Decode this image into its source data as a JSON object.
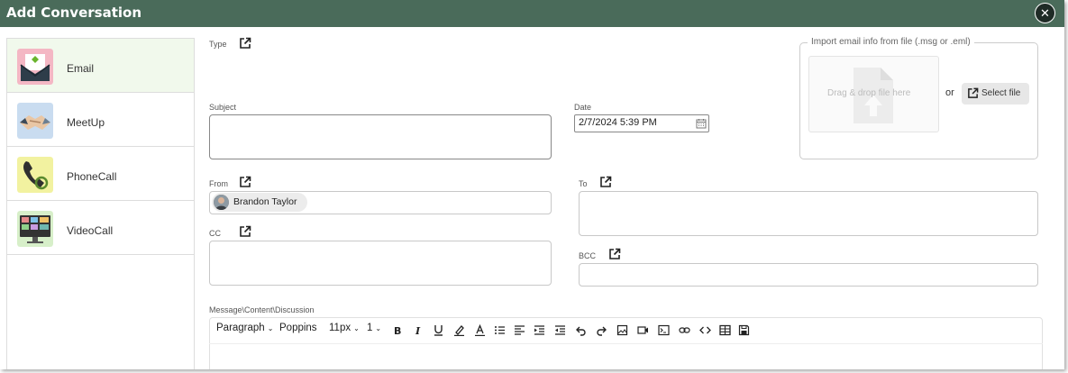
{
  "dialog": {
    "title": "Add Conversation",
    "close_glyph": "✕"
  },
  "sidebar": {
    "items": [
      {
        "label": "Email",
        "icon": "email-envelope-icon",
        "active": true
      },
      {
        "label": "MeetUp",
        "icon": "handshake-icon",
        "active": false
      },
      {
        "label": "PhoneCall",
        "icon": "phone-icon",
        "active": false
      },
      {
        "label": "VideoCall",
        "icon": "video-grid-icon",
        "active": false
      }
    ]
  },
  "form": {
    "type_label": "Type",
    "subject_label": "Subject",
    "subject_value": "",
    "date_label": "Date",
    "date_value": "2/7/2024 5:39 PM",
    "from_label": "From",
    "from_chip": "Brandon Taylor",
    "to_label": "To",
    "cc_label": "CC",
    "bcc_label": "BCC",
    "message_label": "Message\\Content\\Discussion"
  },
  "import": {
    "legend": "Import email info from file (.msg or .eml)",
    "dropzone_text": "Drag & drop file here",
    "or_text": "or",
    "select_button": "Select file"
  },
  "toolbar": {
    "paragraph": "Paragraph",
    "font": "Poppins",
    "size": "11px",
    "line_height": "1",
    "icons": [
      "bold-icon",
      "italic-icon",
      "underline-icon",
      "highlight-icon",
      "font-color-icon",
      "bullet-list-icon",
      "align-left-icon",
      "indent-icon",
      "outdent-icon",
      "undo-icon",
      "redo-icon",
      "image-icon",
      "video-icon",
      "embed-icon",
      "link-icon",
      "code-icon",
      "table-icon",
      "save-icon"
    ]
  },
  "colors": {
    "titlebar": "#4a6b5a",
    "active_item": "#f1f9ec",
    "close_button": "#1f2b26"
  }
}
